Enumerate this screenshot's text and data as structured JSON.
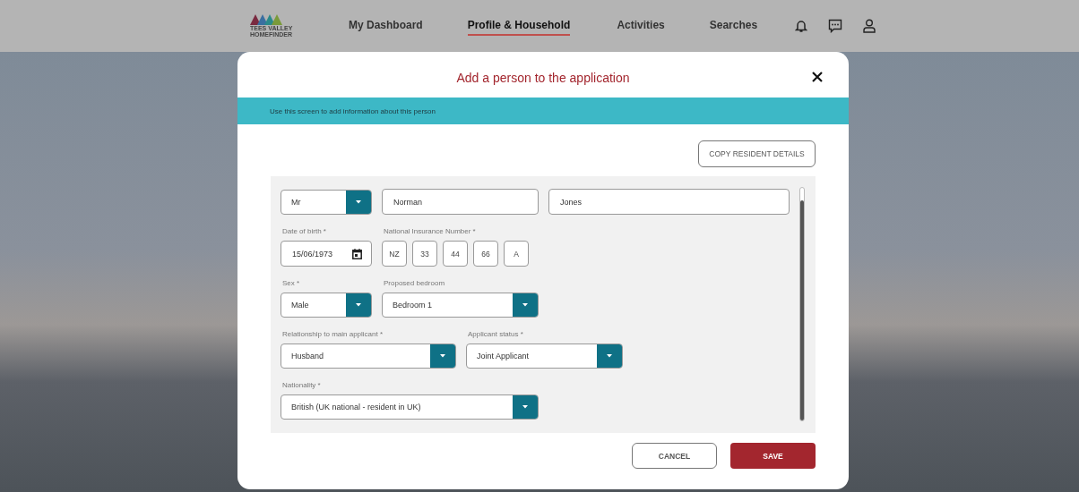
{
  "header": {
    "logo": {
      "line1": "TEES VALLEY",
      "line2": "HOMEFINDER"
    },
    "nav": [
      {
        "label": "My Dashboard",
        "selected": false
      },
      {
        "label": "Profile & Household",
        "selected": true
      },
      {
        "label": "Activities",
        "selected": false
      },
      {
        "label": "Searches",
        "selected": false
      }
    ]
  },
  "dialog": {
    "title": "Add a person to the application",
    "banner": "Use this screen to add information about this person",
    "copy_button": "COPY RESIDENT DETAILS",
    "rows": [
      [
        {
          "kind": "select",
          "value": "Mr"
        },
        {
          "kind": "text",
          "value": "Norman"
        },
        {
          "kind": "text",
          "value": "Jones"
        }
      ],
      [
        {
          "kind": "date",
          "label": "Date of birth *",
          "value": "15/06/1973"
        },
        {
          "kind": "ni",
          "label": "National Insurance Number *",
          "parts": [
            "NZ",
            "33",
            "44",
            "66",
            "A"
          ]
        }
      ],
      [
        {
          "kind": "select",
          "label": "Sex *",
          "value": "Male"
        },
        {
          "kind": "select",
          "label": "Proposed bedroom",
          "value": "Bedroom 1"
        }
      ],
      [
        {
          "kind": "select",
          "label": "Relationship to main applicant *",
          "value": "Husband"
        },
        {
          "kind": "select",
          "label": "Applicant status *",
          "value": "Joint Applicant"
        }
      ],
      [
        {
          "kind": "select",
          "label": "Nationality *",
          "value": "British (UK national - resident in UK)"
        }
      ]
    ],
    "buttons": [
      {
        "kind": "cancel",
        "label": "CANCEL"
      },
      {
        "kind": "save",
        "label": "SAVE"
      }
    ]
  }
}
